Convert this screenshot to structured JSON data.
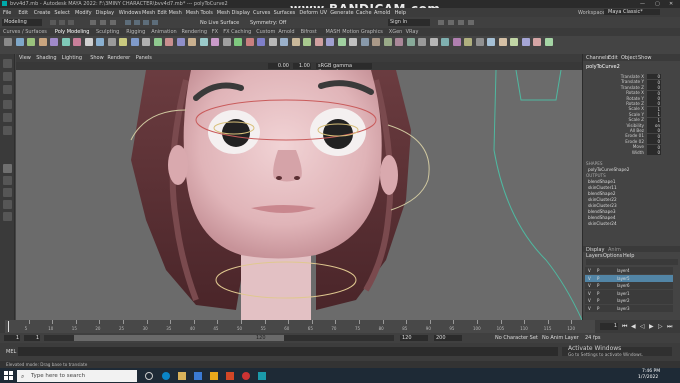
{
  "window": {
    "title": "bvv4d7.mb - Autodesk MAYA 2022: F:\\3MINY CHARACTER\\bvv4d7.mb* --- polyToCurve2",
    "watermark": "www.BANDICAM.com",
    "workspace_label": "Workspace:",
    "workspace_value": "Maya Classic*"
  },
  "menu": [
    "File",
    "Edit",
    "Create",
    "Select",
    "Modify",
    "Display",
    "Windows",
    "Mesh",
    "Edit Mesh",
    "Mesh Tools",
    "Mesh Display",
    "Curves",
    "Surfaces",
    "Deform",
    "UV",
    "Generate",
    "Cache",
    "Arnold",
    "Help"
  ],
  "status_line": {
    "mode": "Modeling",
    "live_surface": "No Live Surface",
    "symmetry": "Symmetry: Off",
    "sign_in": "Sign In"
  },
  "shelf_tabs": [
    "Curves / Surfaces",
    "Poly Modeling",
    "Sculpting",
    "Rigging",
    "Animation",
    "Rendering",
    "FX",
    "FX Caching",
    "Custom",
    "Arnold",
    "Bifrost",
    "MASH",
    "Motion Graphics",
    "XGen",
    "VRay"
  ],
  "viewport": {
    "menu": [
      "View",
      "Shading",
      "Lighting",
      "Show",
      "Renderer",
      "Panels"
    ],
    "exposure": "0.00",
    "gamma": "1.00",
    "color_space": "sRGB gamma (legacy)"
  },
  "channel_box": {
    "tabs": [
      "Channels",
      "Edit",
      "Object",
      "Show"
    ],
    "node": "polyToCurve2",
    "attributes": [
      {
        "name": "Translate X",
        "value": "0"
      },
      {
        "name": "Translate Y",
        "value": "0"
      },
      {
        "name": "Translate Z",
        "value": "0"
      },
      {
        "name": "Rotate X",
        "value": "0"
      },
      {
        "name": "Rotate Y",
        "value": "0"
      },
      {
        "name": "Rotate Z",
        "value": "0"
      },
      {
        "name": "Scale X",
        "value": "1"
      },
      {
        "name": "Scale Y",
        "value": "1"
      },
      {
        "name": "Scale Z",
        "value": "1"
      },
      {
        "name": "Visibility",
        "value": "on"
      },
      {
        "name": "All Bez",
        "value": "0"
      },
      {
        "name": "Erode 01",
        "value": "0"
      },
      {
        "name": "Erode 02",
        "value": "0"
      },
      {
        "name": "Move",
        "value": "0"
      },
      {
        "name": "Width",
        "value": "0"
      }
    ],
    "shapes_header": "SHAPES",
    "shape_node": "polyToCurveShape2",
    "outputs_header": "OUTPUTS",
    "outputs": [
      "blendShape1",
      "skinCluster11",
      "blendShape2",
      "skinCluster22",
      "skinCluster23",
      "blendShape3",
      "blendShape4",
      "skinCluster24"
    ]
  },
  "layer_editor": {
    "tabs": [
      "Display",
      "Anim"
    ],
    "menu": [
      "Layers",
      "Options",
      "Help"
    ],
    "layers": [
      {
        "v": "V",
        "p": "P",
        "name": "layer4"
      },
      {
        "v": "V",
        "p": "P",
        "name": "layer5"
      },
      {
        "v": "V",
        "p": "P",
        "name": "layer6"
      },
      {
        "v": "V",
        "p": "P",
        "name": "layer1"
      },
      {
        "v": "V",
        "p": "P",
        "name": "layer2"
      },
      {
        "v": "V",
        "p": "P",
        "name": "layer3"
      }
    ]
  },
  "time_slider": {
    "ticks": [
      "5",
      "10",
      "15",
      "20",
      "25",
      "30",
      "35",
      "40",
      "45",
      "50",
      "55",
      "60",
      "65",
      "70",
      "75",
      "80",
      "85",
      "90",
      "95",
      "100",
      "105",
      "110",
      "115",
      "120"
    ],
    "current_frame": "1"
  },
  "range_slider": {
    "start": "1",
    "start_inner": "1",
    "end_inner": "120",
    "end": "120",
    "anim_end": "200",
    "character_set": "No Character Set",
    "anim_layer": "No Anim Layer",
    "fps": "24 fps"
  },
  "command_line": {
    "label": "MEL"
  },
  "help_line": "Elevated mode: Drag base to translate",
  "activate_windows": {
    "title": "Activate Windows",
    "subtitle": "Go to Settings to activate Windows."
  },
  "taskbar": {
    "search_placeholder": "Type here to search",
    "time": "7:46 PM",
    "date": "1/7/2022"
  }
}
